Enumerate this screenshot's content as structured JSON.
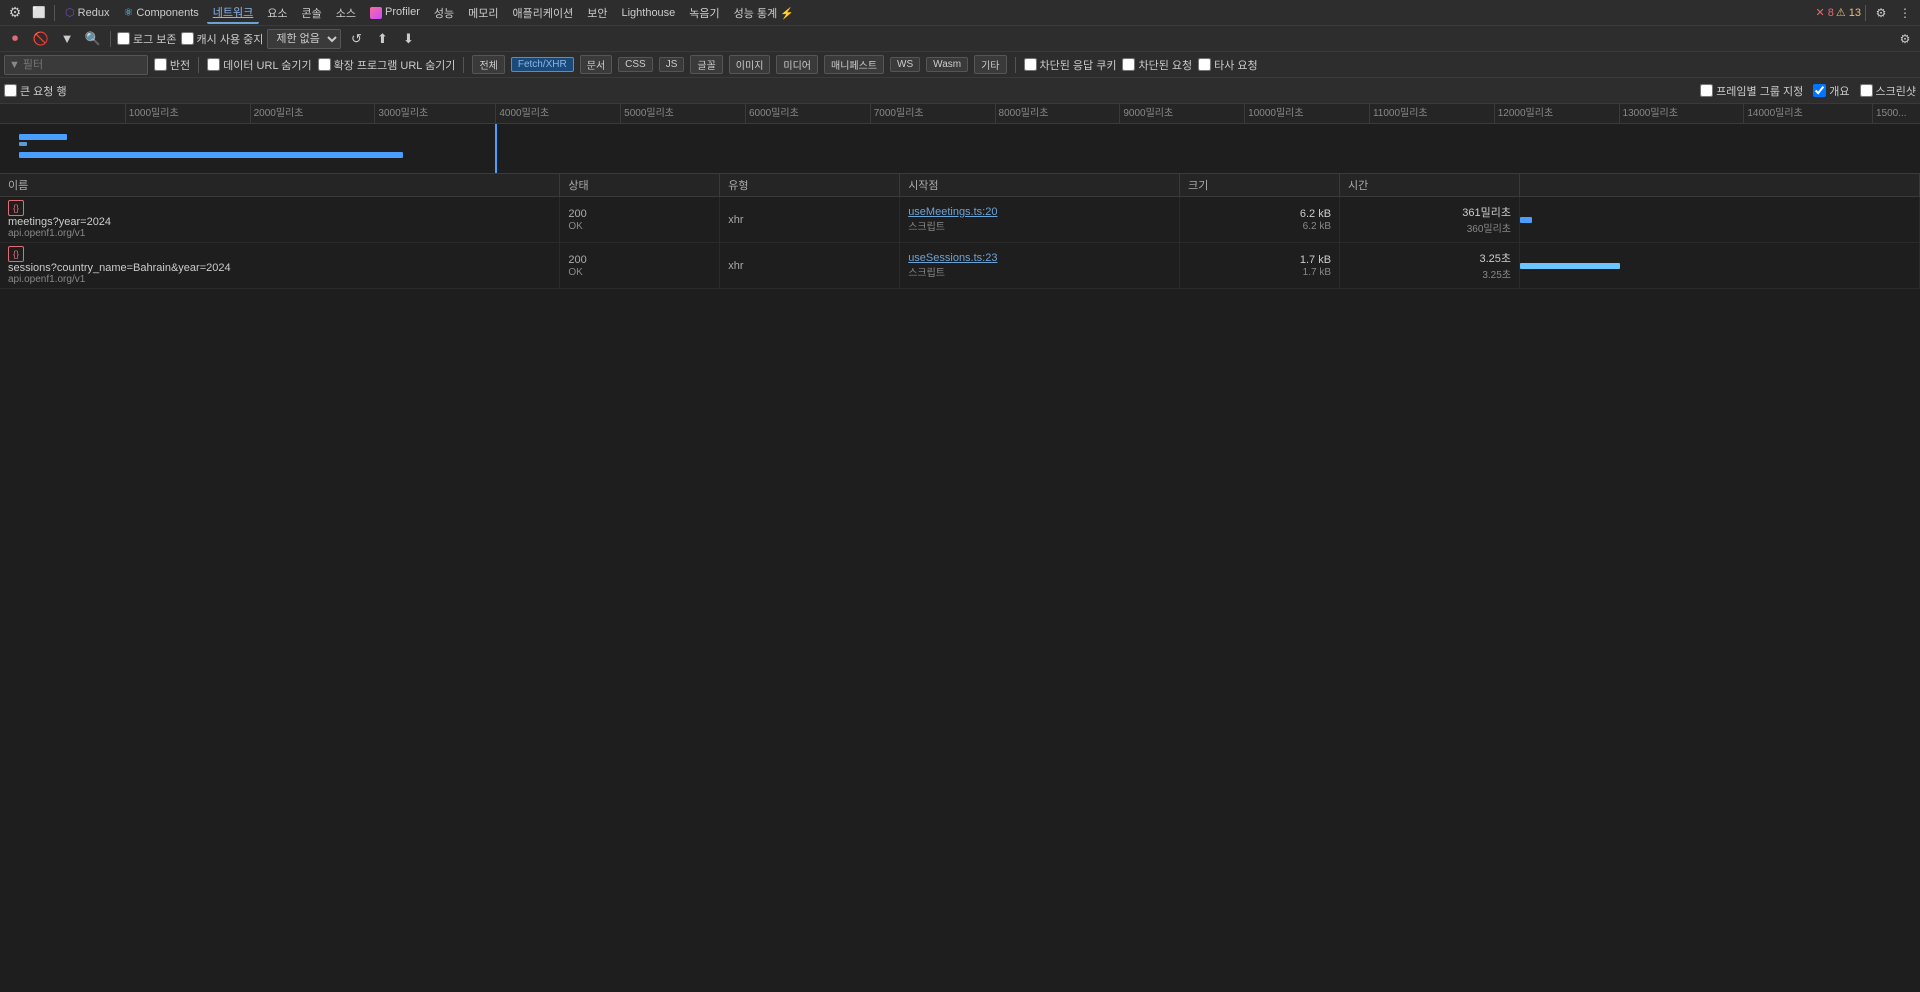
{
  "tabs": {
    "items": [
      {
        "id": "devtools-icon1",
        "label": "⚙",
        "active": false
      },
      {
        "id": "devtools-icon2",
        "label": "⬜",
        "active": false
      },
      {
        "id": "redux",
        "label": "Redux",
        "active": false
      },
      {
        "id": "components",
        "label": "Components",
        "active": false
      },
      {
        "id": "network",
        "label": "네트워크",
        "active": true
      },
      {
        "id": "elements",
        "label": "요소",
        "active": false
      },
      {
        "id": "console",
        "label": "콘솔",
        "active": false
      },
      {
        "id": "sources",
        "label": "소스",
        "active": false
      },
      {
        "id": "profiler",
        "label": "Profiler",
        "active": false
      },
      {
        "id": "performance",
        "label": "성능",
        "active": false
      },
      {
        "id": "memory",
        "label": "메모리",
        "active": false
      },
      {
        "id": "application",
        "label": "애플리케이션",
        "active": false
      },
      {
        "id": "security",
        "label": "보안",
        "active": false
      },
      {
        "id": "lighthouse",
        "label": "Lighthouse",
        "active": false
      },
      {
        "id": "recorder",
        "label": "녹음기",
        "active": false
      },
      {
        "id": "perf-stats",
        "label": "성능 통계 ⚡",
        "active": false
      }
    ]
  },
  "second_toolbar": {
    "record_label": "●",
    "clear_label": "🚫",
    "filter_label": "▾",
    "search_label": "🔍",
    "log_preserve": "로그 보존",
    "cache_disable": "캐시 사용 중지",
    "throttle_label": "제한 없음",
    "import_label": "⬆",
    "export_label": "⬇",
    "settings_label": "⚙"
  },
  "filter_toolbar": {
    "filter_placeholder": "필터",
    "filter_icon": "▾",
    "invert_label": "반전",
    "data_url_label": "데이터 URL 숨기기",
    "ext_program_label": "확장 프로그램 URL 숨기기",
    "all_label": "전체",
    "fetch_xhr_label": "Fetch/XHR",
    "doc_label": "문서",
    "css_label": "CSS",
    "js_label": "JS",
    "font_label": "글꼴",
    "image_label": "이미지",
    "media_label": "미디어",
    "manifest_label": "매니페스트",
    "ws_label": "WS",
    "wasm_label": "Wasm",
    "other_label": "기타",
    "blocked_cookies_label": "차단된 응답 쿠키",
    "blocked_requests_label": "차단된 요청",
    "third_party_label": "타사 요청"
  },
  "options_toolbar": {
    "large_rows_label": "큰 요청 행",
    "group_by_frame_label": "프레임별 그룹 지정",
    "overview_label": "개요",
    "screenshots_label": "스크린샷"
  },
  "timeline": {
    "ticks": [
      {
        "label": "1000밀리초",
        "offset_pct": 6.5
      },
      {
        "label": "2000밀리초",
        "offset_pct": 13.0
      },
      {
        "label": "3000밀리초",
        "offset_pct": 19.5
      },
      {
        "label": "4000밀리초",
        "offset_pct": 25.8
      },
      {
        "label": "5000밀리초",
        "offset_pct": 32.3
      },
      {
        "label": "6000밀리초",
        "offset_pct": 38.8
      },
      {
        "label": "7000밀리초",
        "offset_pct": 45.3
      },
      {
        "label": "8000밀리초",
        "offset_pct": 51.8
      },
      {
        "label": "9000밀리초",
        "offset_pct": 58.3
      },
      {
        "label": "10000밀리초",
        "offset_pct": 64.8
      },
      {
        "label": "11000밀리초",
        "offset_pct": 71.3
      },
      {
        "label": "12000밀리초",
        "offset_pct": 77.8
      },
      {
        "label": "13000밀리초",
        "offset_pct": 84.3
      },
      {
        "label": "14000밀리초",
        "offset_pct": 90.8
      },
      {
        "label": "1500...",
        "offset_pct": 97.5
      }
    ],
    "cursor_pct": 25.8
  },
  "table": {
    "columns": [
      {
        "id": "name",
        "label": "이름"
      },
      {
        "id": "status",
        "label": "상태"
      },
      {
        "id": "type",
        "label": "유형"
      },
      {
        "id": "initiator",
        "label": "시작점"
      },
      {
        "id": "size",
        "label": "크기"
      },
      {
        "id": "time",
        "label": "시간"
      }
    ],
    "rows": [
      {
        "name": "meetings?year=2024",
        "domain": "api.openf1.org/v1",
        "status": "200",
        "status_text": "OK",
        "type": "xhr",
        "initiator": "useMeetings.ts:20",
        "initiator_type": "스크립트",
        "size": "6.2 kB",
        "size_secondary": "6.2 kB",
        "time": "361밀리초",
        "time_secondary": "360밀리초"
      },
      {
        "name": "sessions?country_name=Bahrain&year=2024",
        "domain": "api.openf1.org/v1",
        "status": "200",
        "status_text": "OK",
        "type": "xhr",
        "initiator": "useSessions.ts:23",
        "initiator_type": "스크립트",
        "size": "1.7 kB",
        "size_secondary": "1.7 kB",
        "time": "3.25초",
        "time_secondary": "3.25초"
      }
    ]
  },
  "errors": {
    "error_count": "8",
    "warning_count": "13"
  }
}
